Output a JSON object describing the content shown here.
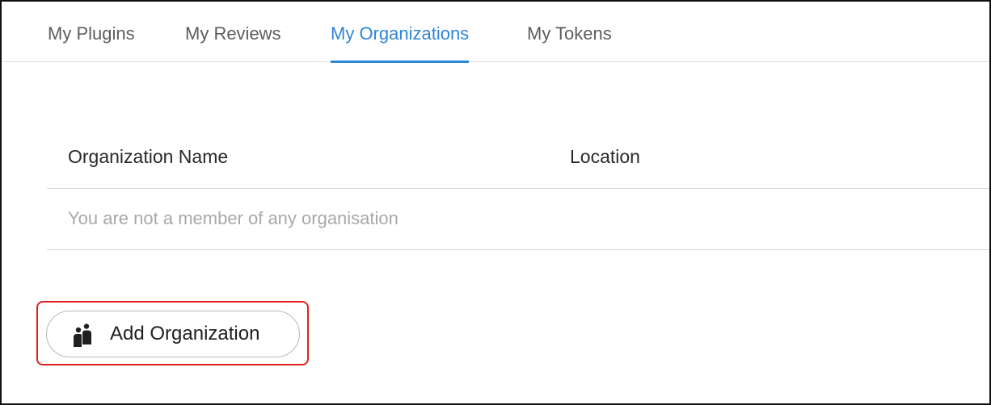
{
  "tabs": [
    {
      "label": "My Plugins",
      "active": false
    },
    {
      "label": "My Reviews",
      "active": false
    },
    {
      "label": "My Organizations",
      "active": true
    },
    {
      "label": "My Tokens",
      "active": false
    }
  ],
  "table": {
    "columns": [
      "Organization Name",
      "Location"
    ],
    "empty_message": "You are not a member of any organisation"
  },
  "add_button": {
    "label": "Add Organization",
    "icon": "group-icon"
  },
  "colors": {
    "accent": "#2f86d6",
    "highlight_border": "#e02020",
    "muted_text": "#a8a8a8"
  }
}
